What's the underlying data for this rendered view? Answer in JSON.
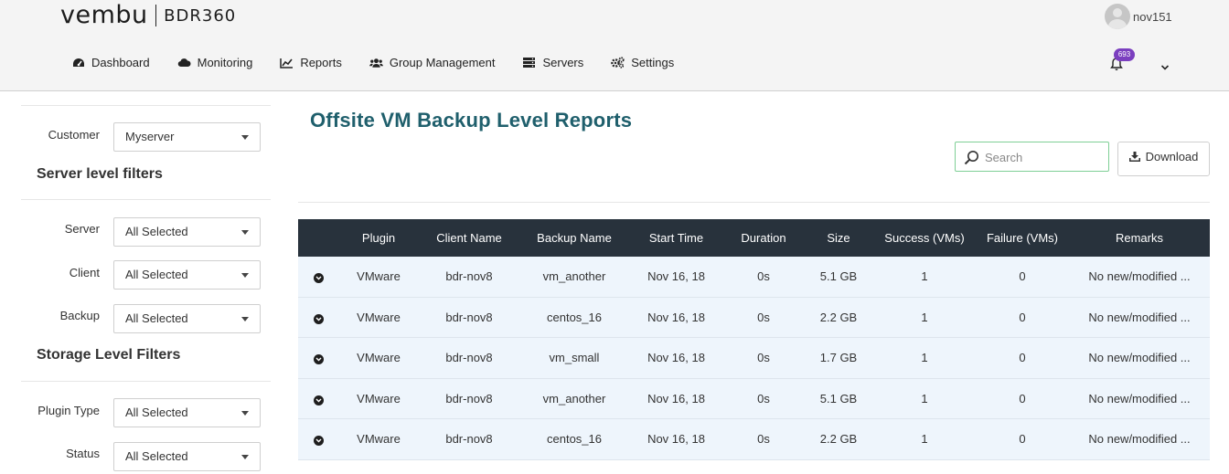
{
  "brand": {
    "name": "vembu",
    "product": "BDR360"
  },
  "user": {
    "name": "nov151"
  },
  "nav": [
    {
      "label": "Dashboard",
      "icon": "dashboard-icon"
    },
    {
      "label": "Monitoring",
      "icon": "cloud-icon"
    },
    {
      "label": "Reports",
      "icon": "line-chart-icon"
    },
    {
      "label": "Group Management",
      "icon": "users-icon"
    },
    {
      "label": "Servers",
      "icon": "server-icon"
    },
    {
      "label": "Settings",
      "icon": "gears-icon"
    }
  ],
  "notifications": {
    "count": "693",
    "icon": "bell-icon"
  },
  "sidebar": {
    "customer": {
      "label": "Customer",
      "value": "Myserver"
    },
    "server_level": {
      "heading": "Server level filters",
      "filters": [
        {
          "label": "Server",
          "value": "All Selected"
        },
        {
          "label": "Client",
          "value": "All Selected"
        },
        {
          "label": "Backup",
          "value": "All Selected"
        }
      ]
    },
    "storage_level": {
      "heading": "Storage Level Filters",
      "filters": [
        {
          "label": "Plugin Type",
          "value": "All Selected"
        },
        {
          "label": "Status",
          "value": "All Selected"
        }
      ]
    }
  },
  "main": {
    "title": "Offsite VM Backup Level Reports",
    "search": {
      "placeholder": "Search",
      "value": ""
    },
    "download_label": "Download"
  },
  "table": {
    "columns": [
      "",
      "Plugin",
      "Client Name",
      "Backup Name",
      "Start Time",
      "Duration",
      "Size",
      "Success (VMs)",
      "Failure (VMs)",
      "Remarks"
    ],
    "rows": [
      [
        "VMware",
        "bdr-nov8",
        "vm_another",
        "Nov 16, 18",
        "0s",
        "5.1 GB",
        "1",
        "0",
        "No new/modified ..."
      ],
      [
        "VMware",
        "bdr-nov8",
        "centos_16",
        "Nov 16, 18",
        "0s",
        "2.2 GB",
        "1",
        "0",
        "No new/modified ..."
      ],
      [
        "VMware",
        "bdr-nov8",
        "vm_small",
        "Nov 16, 18",
        "0s",
        "1.7 GB",
        "1",
        "0",
        "No new/modified ..."
      ],
      [
        "VMware",
        "bdr-nov8",
        "vm_another",
        "Nov 16, 18",
        "0s",
        "5.1 GB",
        "1",
        "0",
        "No new/modified ..."
      ],
      [
        "VMware",
        "bdr-nov8",
        "centos_16",
        "Nov 16, 18",
        "0s",
        "2.2 GB",
        "1",
        "0",
        "No new/modified ..."
      ]
    ]
  },
  "colors": {
    "title": "#1f5f6c",
    "table_header": "#28323c",
    "row_bg": "#eef5fc",
    "badge": "#7b3fbf",
    "search_border": "#7ecf95"
  }
}
